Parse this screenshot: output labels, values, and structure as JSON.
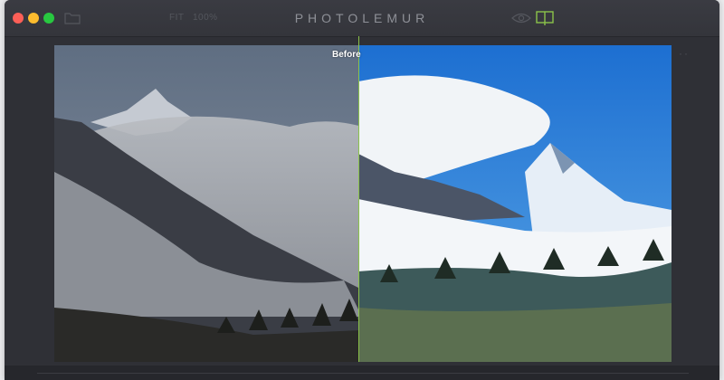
{
  "window": {
    "title": "PHOTOLEMUR",
    "zoom_fit_label": "FIT",
    "zoom_percent_label": "100%",
    "icons": [
      "folder-icon",
      "eye-icon",
      "compare-split-icon",
      "more-icon"
    ]
  },
  "viewer": {
    "before_label": "Before",
    "divider_color": "#8bc34a"
  },
  "colors": {
    "window_bg": "#2f3036",
    "title_text": "#8e9097",
    "accent": "#8bc34a",
    "traffic_close": "#fc5f57",
    "traffic_minimize": "#fdbc2e",
    "traffic_maximize": "#28c840"
  }
}
